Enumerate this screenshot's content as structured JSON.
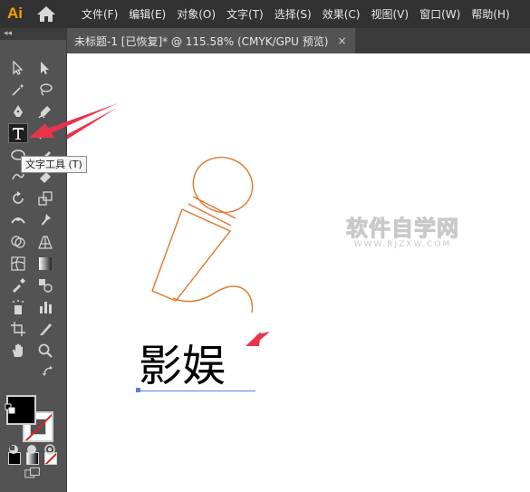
{
  "app": {
    "logo": "Ai",
    "home_icon": "home-icon"
  },
  "menu": {
    "items": [
      "文件(F)",
      "编辑(E)",
      "对象(O)",
      "文字(T)",
      "选择(S)",
      "效果(C)",
      "视图(V)",
      "窗口(W)",
      "帮助(H)"
    ]
  },
  "toolbar": {
    "collapse_label": "◂◂",
    "tooltip": "文字工具 (T)",
    "active_tool": "type-tool"
  },
  "document": {
    "tab_title": "未标题-1 [已恢复]* @ 115.58% (CMYK/GPU 预览)",
    "close_label": "×",
    "zoom": "115.58%",
    "color_mode": "CMYK/GPU 预览"
  },
  "canvas": {
    "text": "影娱",
    "watermark_main": "软件自学网",
    "watermark_sub": "WWW.RJZXW.COM",
    "microphone_color": "#e0762a",
    "arrow_color": "#e8344a"
  },
  "colors": {
    "fill": "#000000",
    "stroke": "none",
    "accent": "#e8344a",
    "tool_icon": "#d6d6d6"
  }
}
